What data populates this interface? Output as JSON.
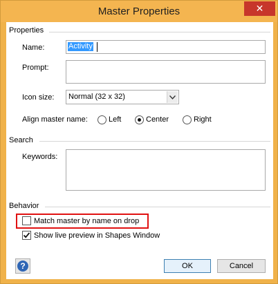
{
  "dialog": {
    "title": "Master Properties",
    "close_glyph": "✕"
  },
  "properties": {
    "group_label": "Properties",
    "name_label": "Name:",
    "name_value": "Activity",
    "prompt_label": "Prompt:",
    "prompt_value": "",
    "icon_size_label": "Icon size:",
    "icon_size_value": "Normal (32 x 32)",
    "align_label": "Align master name:",
    "align_options": [
      "Left",
      "Center",
      "Right"
    ],
    "align_selected": "Center"
  },
  "search": {
    "group_label": "Search",
    "keywords_label": "Keywords:",
    "keywords_value": ""
  },
  "behavior": {
    "group_label": "Behavior",
    "match_label": "Match master by name on drop",
    "match_checked": false,
    "preview_label": "Show live preview in Shapes Window",
    "preview_checked": true
  },
  "buttons": {
    "ok": "OK",
    "cancel": "Cancel",
    "help_glyph": "?"
  },
  "colors": {
    "title_bar": "#f4b550",
    "close_button": "#c7362b",
    "highlight_box": "#e01010",
    "selection": "#3399ff"
  },
  "icons": {
    "close": "close-icon",
    "help": "help-icon",
    "dropdown": "chevron-down-icon",
    "check": "checkmark-icon"
  }
}
